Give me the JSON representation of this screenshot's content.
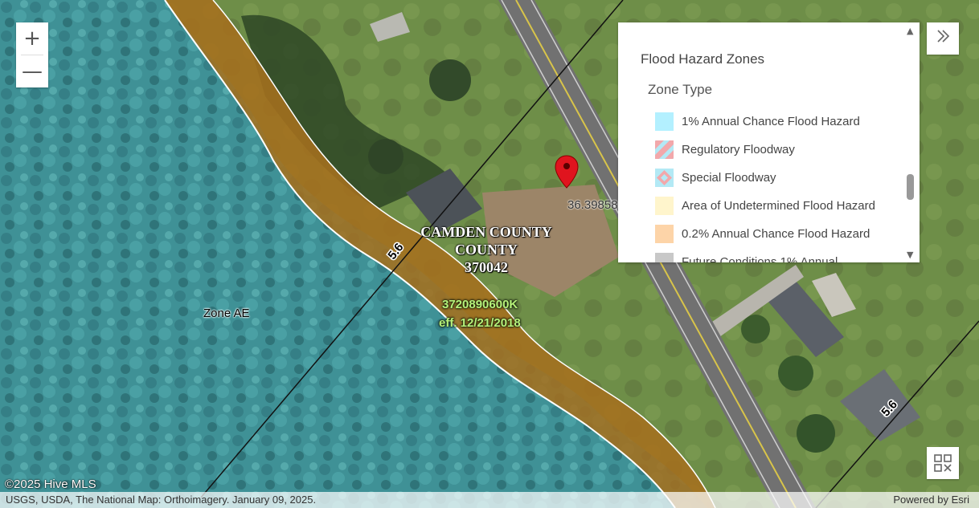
{
  "map": {
    "zoom_in_label": "+",
    "zoom_out_label": "—",
    "zone_label": "Zone AE",
    "county_lines": [
      "CAMDEN COUNTY",
      "COUNTY",
      "370042"
    ],
    "panel_number": "3720890600K",
    "panel_effective": "eff. 12/21/2018",
    "bfe_left": "5.6",
    "bfe_right": "5.6",
    "coordinate_partial": "36.39858",
    "copyright": "©2025 Hive MLS",
    "attribution": "USGS, USDA, The National Map: Orthoimagery. January 09, 2025.",
    "powered_by": "Powered by Esri",
    "expand_icon": "double-chevron-right-icon",
    "marker_icon": "map-pin-icon"
  },
  "legend": {
    "layer_title": "Flood Hazard Zones",
    "subtitle": "Zone Type",
    "items": [
      {
        "label": "1% Annual Chance Flood Hazard",
        "color": "#b3f0ff",
        "pattern": "solid"
      },
      {
        "label": "Regulatory Floodway",
        "color": "#f2a8ab",
        "pattern": "diagonal"
      },
      {
        "label": "Special Floodway",
        "color": "#f2a8ab",
        "pattern": "diamond"
      },
      {
        "label": "Area of Undetermined Flood Hazard",
        "color": "#fff5cc",
        "pattern": "solid"
      },
      {
        "label": "0.2% Annual Chance Flood Hazard",
        "color": "#fdd4a8",
        "pattern": "solid"
      },
      {
        "label": "Future Conditions 1% Annual",
        "color": "#c8c8c8",
        "pattern": "solid"
      }
    ]
  },
  "colors": {
    "flood_zone": "#2f9aa6",
    "floodway_band": "#a5701e",
    "grass": "#6e8e48",
    "road": "#6f6f6f"
  }
}
